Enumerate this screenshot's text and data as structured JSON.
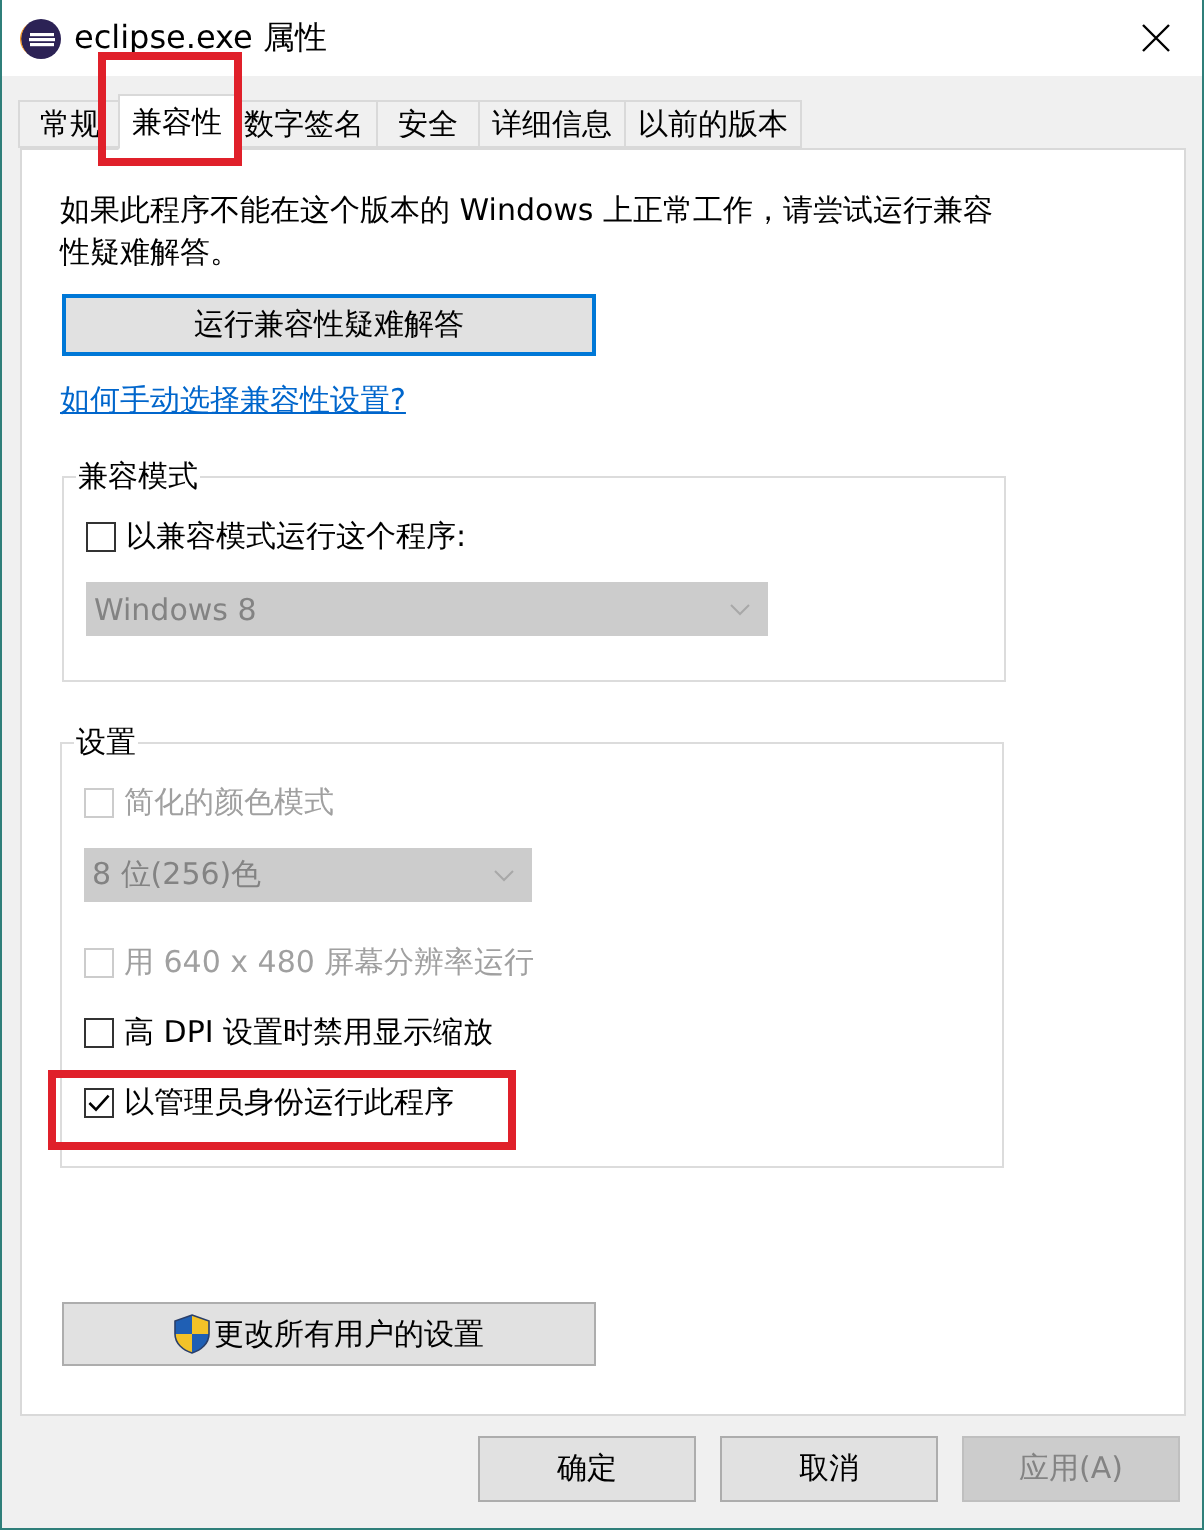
{
  "window": {
    "title": "eclipse.exe 属性"
  },
  "tabs": [
    {
      "label": "常规",
      "selected": false,
      "annotated": false
    },
    {
      "label": "兼容性",
      "selected": true,
      "annotated": true
    },
    {
      "label": "数字签名",
      "selected": false,
      "annotated": false
    },
    {
      "label": "安全",
      "selected": false,
      "annotated": false
    },
    {
      "label": "详细信息",
      "selected": false,
      "annotated": false
    },
    {
      "label": "以前的版本",
      "selected": false,
      "annotated": false
    }
  ],
  "intro": "如果此程序不能在这个版本的 Windows 上正常工作，请尝试运行兼容性疑难解答。",
  "troubleshoot_button": {
    "label": "运行兼容性疑难解答",
    "focused": true
  },
  "help_link": "如何手动选择兼容性设置?",
  "groups": [
    {
      "title": "兼容模式",
      "items": [
        {
          "kind": "checkbox",
          "label": "以兼容模式运行这个程序:",
          "checked": false,
          "disabled": false,
          "annotated": false
        },
        {
          "kind": "dropdown",
          "value": "Windows 8",
          "disabled": true
        }
      ]
    },
    {
      "title": "设置",
      "items": [
        {
          "kind": "checkbox",
          "label": "简化的颜色模式",
          "checked": false,
          "disabled": true,
          "annotated": false
        },
        {
          "kind": "dropdown",
          "value": "8 位(256)色",
          "disabled": true
        },
        {
          "kind": "checkbox",
          "label": "用 640 x 480 屏幕分辨率运行",
          "checked": false,
          "disabled": true,
          "annotated": false
        },
        {
          "kind": "checkbox",
          "label": "高 DPI 设置时禁用显示缩放",
          "checked": false,
          "disabled": false,
          "annotated": false
        },
        {
          "kind": "checkbox",
          "label": "以管理员身份运行此程序",
          "checked": true,
          "disabled": false,
          "annotated": true
        }
      ]
    }
  ],
  "all_users_button": {
    "label": "更改所有用户的设置"
  },
  "footer_buttons": [
    {
      "label": "确定",
      "disabled": false
    },
    {
      "label": "取消",
      "disabled": false
    },
    {
      "label": "应用(A)",
      "disabled": true
    }
  ]
}
